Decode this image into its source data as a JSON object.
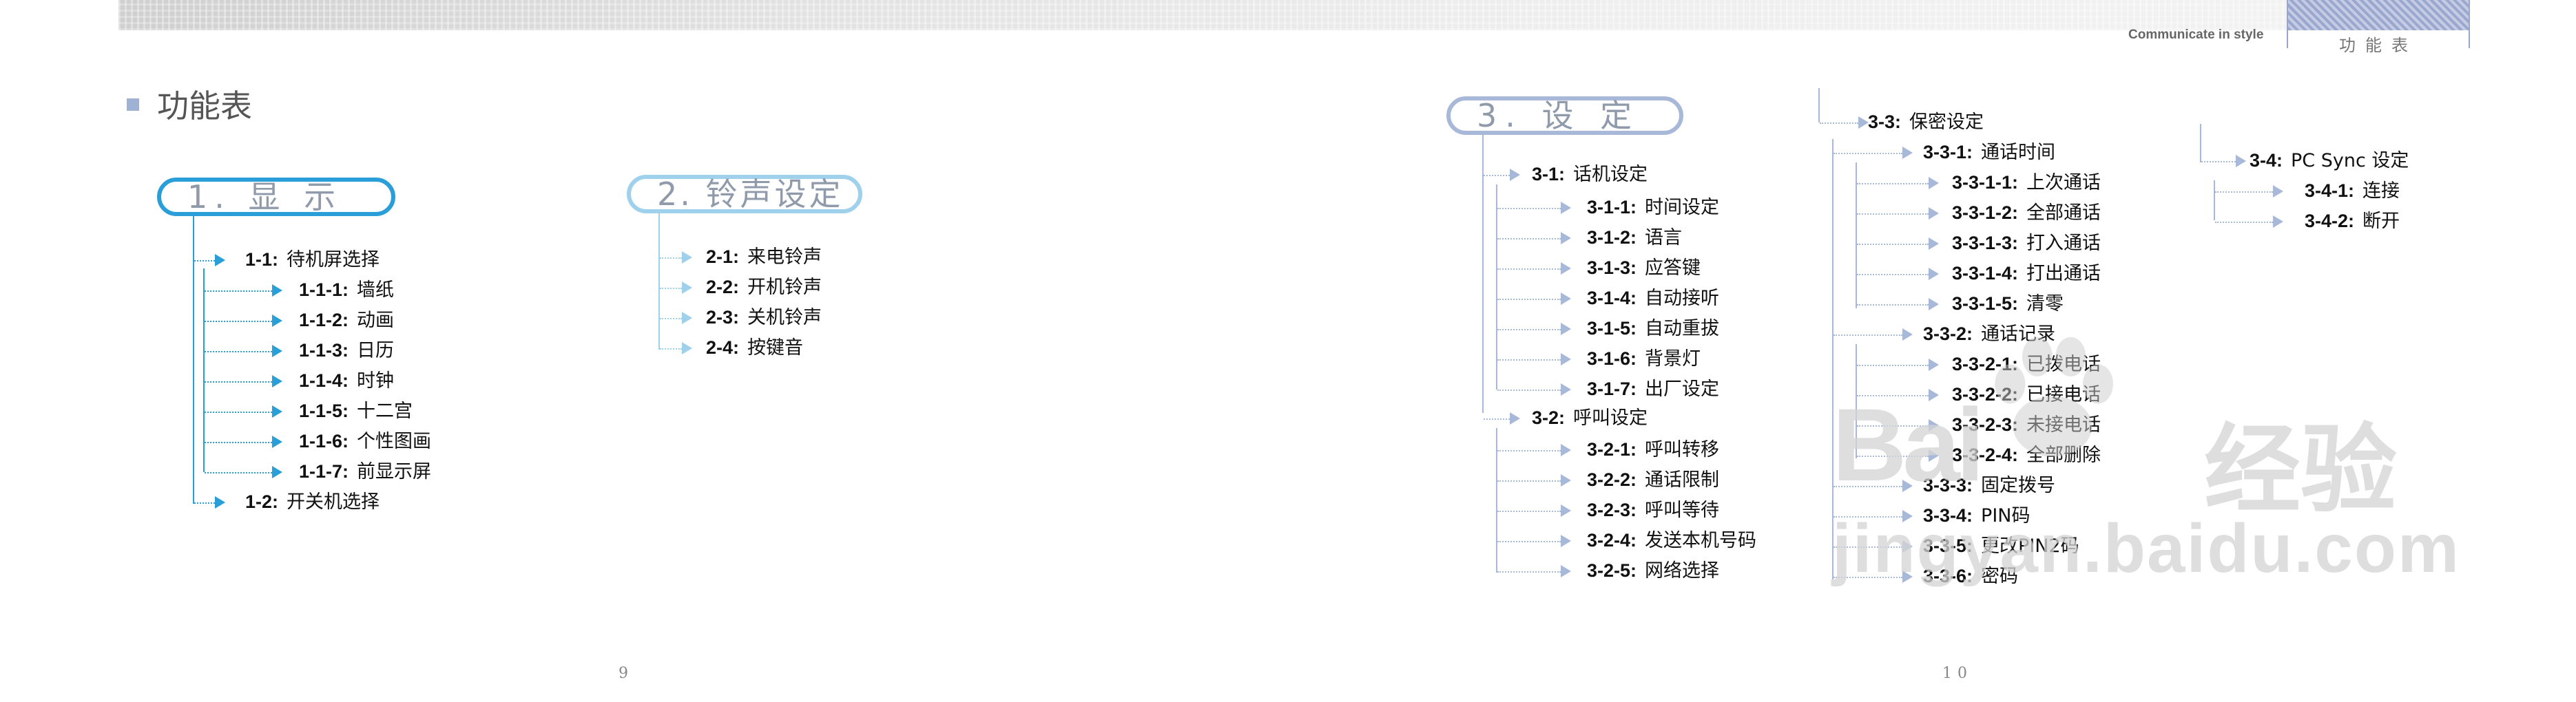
{
  "header": {
    "tagline": "Communicate in style",
    "badge_label": "功能表"
  },
  "page_title": "功能表",
  "sections": {
    "display": {
      "title": "1. 显 示",
      "items": [
        {
          "code": "1-1:",
          "label": "待机屏选择"
        },
        {
          "code": "1-1-1:",
          "label": "墙纸"
        },
        {
          "code": "1-1-2:",
          "label": "动画"
        },
        {
          "code": "1-1-3:",
          "label": "日历"
        },
        {
          "code": "1-1-4:",
          "label": "时钟"
        },
        {
          "code": "1-1-5:",
          "label": "十二宫"
        },
        {
          "code": "1-1-6:",
          "label": "个性图画"
        },
        {
          "code": "1-1-7:",
          "label": "前显示屏"
        },
        {
          "code": "1-2:",
          "label": "开关机选择"
        }
      ]
    },
    "ringtone": {
      "title": "2. 铃声设定",
      "items": [
        {
          "code": "2-1:",
          "label": "来电铃声"
        },
        {
          "code": "2-2:",
          "label": "开机铃声"
        },
        {
          "code": "2-3:",
          "label": "关机铃声"
        },
        {
          "code": "2-4:",
          "label": "按键音"
        }
      ]
    },
    "settings": {
      "title": "3. 设 定",
      "items": [
        {
          "code": "3-1:",
          "label": "话机设定"
        },
        {
          "code": "3-1-1:",
          "label": "时间设定"
        },
        {
          "code": "3-1-2:",
          "label": "语言"
        },
        {
          "code": "3-1-3:",
          "label": "应答键"
        },
        {
          "code": "3-1-4:",
          "label": "自动接听"
        },
        {
          "code": "3-1-5:",
          "label": "自动重拔"
        },
        {
          "code": "3-1-6:",
          "label": "背景灯"
        },
        {
          "code": "3-1-7:",
          "label": "出厂设定"
        },
        {
          "code": "3-2:",
          "label": "呼叫设定"
        },
        {
          "code": "3-2-1:",
          "label": "呼叫转移"
        },
        {
          "code": "3-2-2:",
          "label": "通话限制"
        },
        {
          "code": "3-2-3:",
          "label": "呼叫等待"
        },
        {
          "code": "3-2-4:",
          "label": "发送本机号码"
        },
        {
          "code": "3-2-5:",
          "label": "网络选择"
        }
      ]
    },
    "security": {
      "items": [
        {
          "code": "3-3:",
          "label": "保密设定"
        },
        {
          "code": "3-3-1:",
          "label": "通话时间"
        },
        {
          "code": "3-3-1-1:",
          "label": "上次通话"
        },
        {
          "code": "3-3-1-2:",
          "label": "全部通话"
        },
        {
          "code": "3-3-1-3:",
          "label": "打入通话"
        },
        {
          "code": "3-3-1-4:",
          "label": "打出通话"
        },
        {
          "code": "3-3-1-5:",
          "label": "清零"
        },
        {
          "code": "3-3-2:",
          "label": "通话记录"
        },
        {
          "code": "3-3-2-1:",
          "label": "已拨电话"
        },
        {
          "code": "3-3-2-2:",
          "label": "已接电话"
        },
        {
          "code": "3-3-2-3:",
          "label": "未接电话"
        },
        {
          "code": "3-3-2-4:",
          "label": "全部删除"
        },
        {
          "code": "3-3-3:",
          "label": "固定拨号"
        },
        {
          "code": "3-3-4:",
          "label": "PIN码"
        },
        {
          "code": "3-3-5:",
          "label": "更改PIN2码"
        },
        {
          "code": "3-3-6:",
          "label": "密码"
        }
      ]
    },
    "pcsync": {
      "items": [
        {
          "code": "3-4:",
          "label": "PC Sync 设定"
        },
        {
          "code": "3-4-1:",
          "label": "连接"
        },
        {
          "code": "3-4-2:",
          "label": "断开"
        }
      ]
    }
  },
  "page_numbers": {
    "left": "9",
    "right": "10"
  },
  "watermark": {
    "brand": "Bai",
    "suffix": "经验",
    "url": "jingyan.baidu.com"
  },
  "colors": {
    "blue_strong": "#2a9ed8",
    "blue_light": "#9fd1ec",
    "slate": "#a8b8d8"
  }
}
